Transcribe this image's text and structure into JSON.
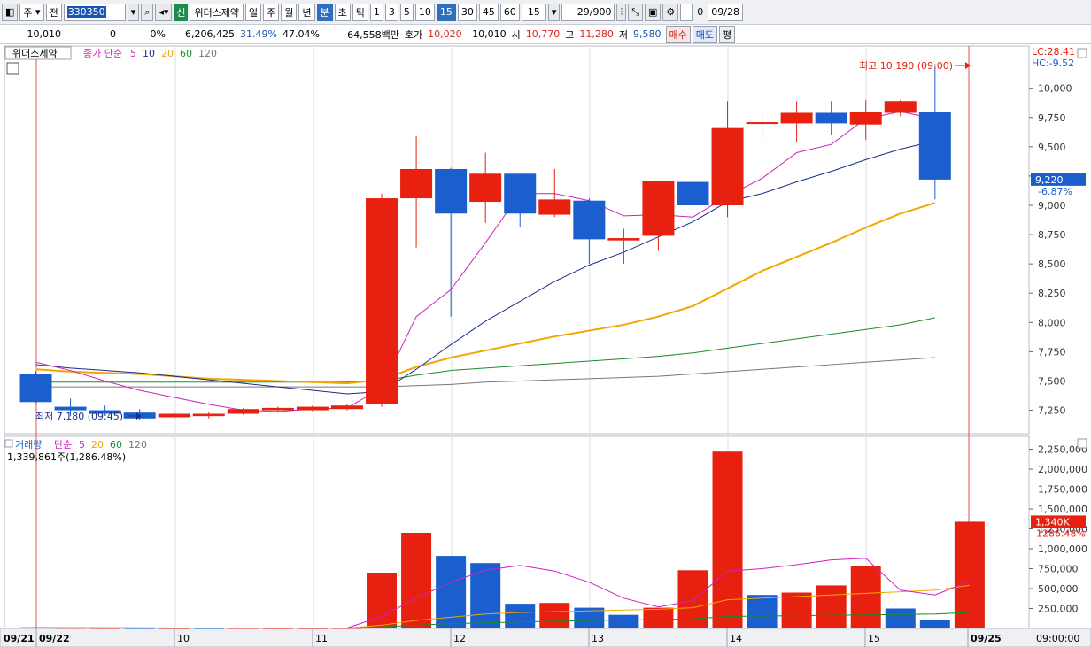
{
  "toolbar": {
    "market": "주",
    "prev": "전",
    "code": "330350",
    "badge": "신",
    "stock_name": "위더스제약",
    "periods": [
      "일",
      "주",
      "월",
      "년"
    ],
    "units": [
      "분",
      "초",
      "틱"
    ],
    "intervals": [
      "1",
      "3",
      "5",
      "10",
      "15",
      "30",
      "45",
      "60"
    ],
    "interval_value": "15",
    "count": "29/900",
    "check_value": "0",
    "date": "09/28"
  },
  "info": {
    "price": "10,010",
    "change": "0",
    "change_pct": "0%",
    "volume": "6,206,425",
    "turnover_pct": "31.49%",
    "vol_ratio": "47.04%",
    "amount": "64,558백만",
    "quote_label": "호가",
    "ask": "10,020",
    "bid": "10,010",
    "open_label": "시",
    "open": "10,770",
    "high_label": "고",
    "high": "11,280",
    "low_label": "저",
    "low": "9,580",
    "buy_label": "매수",
    "sell_label": "매도",
    "avg_label": "평"
  },
  "price_panel": {
    "legend_name": "위더스제약",
    "legend_ma_label": "종가 단순",
    "ma_periods": [
      "5",
      "10",
      "20",
      "60",
      "120"
    ],
    "lc_label": "LC:28.41",
    "hc_label": "HC:-9.52",
    "high_annot": "최고 10,190 (09:00)",
    "low_annot": "최저 7,180 (09:45)",
    "current_price": "9,220",
    "current_pct": "-6.87%",
    "y_ticks": [
      "10,000",
      "9,750",
      "9,500",
      "9,250",
      "9,000",
      "8,750",
      "8,500",
      "8,250",
      "8,000",
      "7,750",
      "7,500",
      "7,250"
    ]
  },
  "volume_panel": {
    "legend_label": "거래량",
    "legend_ma_label": "단순",
    "ma_periods": [
      "5",
      "20",
      "60",
      "120"
    ],
    "summary": "1,339,861주(1,286.48%)",
    "current_vol": "1,340K",
    "current_pct": "1286.48%",
    "y_ticks": [
      "2,250,000",
      "2,000,000",
      "1,750,000",
      "1,500,000",
      "1,250,000",
      "1,000,000",
      "750,000",
      "500,000",
      "250,000"
    ]
  },
  "x_axis": {
    "labels": [
      "09/21",
      "09/22",
      "10",
      "11",
      "12",
      "13",
      "14",
      "15",
      "09/25"
    ],
    "right_label": "09:00:00"
  },
  "colors": {
    "up": "#e8200f",
    "down": "#1b5fcf",
    "ma5": "#d020c0",
    "ma10": "#1a2e8a",
    "ma20": "#f0a800",
    "ma60": "#1c8a2a",
    "ma120": "#777777"
  },
  "chart_data": {
    "type": "candlestick",
    "candles": [
      {
        "o": 7560,
        "h": 7580,
        "l": 7310,
        "c": 7320
      },
      {
        "o": 7280,
        "h": 7350,
        "l": 7200,
        "c": 7250
      },
      {
        "o": 7250,
        "h": 7290,
        "l": 7210,
        "c": 7220
      },
      {
        "o": 7230,
        "h": 7260,
        "l": 7170,
        "c": 7180
      },
      {
        "o": 7190,
        "h": 7240,
        "l": 7180,
        "c": 7220
      },
      {
        "o": 7200,
        "h": 7240,
        "l": 7180,
        "c": 7220
      },
      {
        "o": 7220,
        "h": 7270,
        "l": 7210,
        "c": 7260
      },
      {
        "o": 7250,
        "h": 7280,
        "l": 7230,
        "c": 7270
      },
      {
        "o": 7250,
        "h": 7290,
        "l": 7240,
        "c": 7280
      },
      {
        "o": 7260,
        "h": 7300,
        "l": 7250,
        "c": 7290
      },
      {
        "o": 7300,
        "h": 9100,
        "l": 7280,
        "c": 9060
      },
      {
        "o": 9060,
        "h": 9590,
        "l": 8640,
        "c": 9310
      },
      {
        "o": 9310,
        "h": 9320,
        "l": 8050,
        "c": 8930
      },
      {
        "o": 9030,
        "h": 9450,
        "l": 8850,
        "c": 9270
      },
      {
        "o": 9270,
        "h": 9270,
        "l": 8810,
        "c": 8930
      },
      {
        "o": 8920,
        "h": 9310,
        "l": 8900,
        "c": 9050
      },
      {
        "o": 9040,
        "h": 9060,
        "l": 8500,
        "c": 8710
      },
      {
        "o": 8700,
        "h": 8800,
        "l": 8500,
        "c": 8720
      },
      {
        "o": 8740,
        "h": 9200,
        "l": 8610,
        "c": 9210
      },
      {
        "o": 9200,
        "h": 9410,
        "l": 9000,
        "c": 9000
      },
      {
        "o": 9000,
        "h": 9890,
        "l": 8900,
        "c": 9660
      },
      {
        "o": 9700,
        "h": 9770,
        "l": 9560,
        "c": 9710
      },
      {
        "o": 9700,
        "h": 9890,
        "l": 9540,
        "c": 9790
      },
      {
        "o": 9790,
        "h": 9890,
        "l": 9600,
        "c": 9700
      },
      {
        "o": 9690,
        "h": 9900,
        "l": 9560,
        "c": 9800
      },
      {
        "o": 9790,
        "h": 9900,
        "l": 9760,
        "c": 9890
      },
      {
        "o": 9800,
        "h": 10190,
        "l": 9050,
        "c": 9220
      }
    ],
    "ma5": [
      7660,
      7590,
      7500,
      7420,
      7360,
      7300,
      7250,
      7240,
      7260,
      7270,
      7440,
      8050,
      8280,
      8680,
      9100,
      9100,
      9040,
      8910,
      8920,
      8900,
      9080,
      9230,
      9450,
      9520,
      9740,
      9800,
      9740
    ],
    "ma10": [
      7640,
      7610,
      7590,
      7570,
      7540,
      7510,
      7480,
      7450,
      7420,
      7390,
      7410,
      7600,
      7810,
      8010,
      8180,
      8350,
      8490,
      8600,
      8730,
      8860,
      9030,
      9100,
      9200,
      9290,
      9390,
      9480,
      9550
    ],
    "ma20": [
      7600,
      7580,
      7570,
      7560,
      7540,
      7520,
      7510,
      7500,
      7490,
      7480,
      7510,
      7620,
      7700,
      7760,
      7820,
      7880,
      7930,
      7980,
      8050,
      8140,
      8290,
      8440,
      8560,
      8680,
      8810,
      8930,
      9020
    ],
    "ma60": [
      7490,
      7490,
      7490,
      7490,
      7490,
      7490,
      7490,
      7490,
      7490,
      7490,
      7500,
      7550,
      7590,
      7610,
      7630,
      7650,
      7670,
      7690,
      7710,
      7740,
      7780,
      7820,
      7860,
      7900,
      7940,
      7980,
      8040
    ],
    "ma120": [
      7450,
      7450,
      7450,
      7450,
      7450,
      7450,
      7450,
      7450,
      7450,
      7450,
      7450,
      7460,
      7470,
      7490,
      7500,
      7510,
      7520,
      7530,
      7540,
      7560,
      7580,
      7600,
      7620,
      7640,
      7660,
      7680,
      7700
    ],
    "volume": [
      15000,
      8000,
      6000,
      5000,
      5000,
      5000,
      6000,
      5000,
      5000,
      6000,
      700000,
      1200000,
      910000,
      820000,
      310000,
      320000,
      260000,
      170000,
      260000,
      730000,
      2220000,
      420000,
      450000,
      540000,
      780000,
      250000,
      100000,
      1340000
    ],
    "volume_colors": [
      "up",
      "up",
      "up",
      "down",
      "up",
      "down",
      "up",
      "up",
      "up",
      "up",
      "up",
      "up",
      "down",
      "down",
      "down",
      "up",
      "down",
      "down",
      "up",
      "up",
      "up",
      "down",
      "up",
      "up",
      "up",
      "down",
      "down",
      "up"
    ],
    "vol_ma5": [
      10000,
      9000,
      8000,
      7000,
      6000,
      6000,
      6000,
      6000,
      6000,
      6000,
      150000,
      380000,
      580000,
      730000,
      790000,
      720000,
      580000,
      380000,
      270000,
      350000,
      720000,
      750000,
      800000,
      860000,
      880000,
      480000,
      420000,
      590000
    ],
    "vol_ma20": [
      8000,
      8000,
      7000,
      7000,
      6000,
      6000,
      6000,
      6000,
      6000,
      6000,
      40000,
      100000,
      140000,
      180000,
      200000,
      210000,
      220000,
      230000,
      240000,
      260000,
      360000,
      380000,
      400000,
      420000,
      440000,
      460000,
      480000,
      540000
    ],
    "vol_ma60": [
      6000,
      6000,
      6000,
      6000,
      6000,
      6000,
      6000,
      6000,
      6000,
      6000,
      20000,
      40000,
      60000,
      70000,
      80000,
      90000,
      100000,
      105000,
      110000,
      120000,
      150000,
      155000,
      160000,
      165000,
      170000,
      175000,
      180000,
      200000
    ],
    "y_range": [
      7050,
      10300
    ],
    "vol_range": [
      0,
      2300000
    ]
  }
}
